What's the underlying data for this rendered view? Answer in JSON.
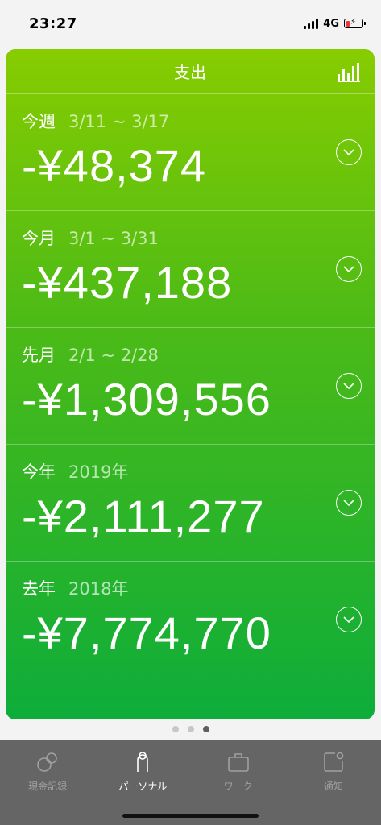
{
  "status_bar": {
    "time": "23:27",
    "network": "4G"
  },
  "card": {
    "title": "支出",
    "chart_icon": "bar-chart-icon",
    "rows": [
      {
        "label": "今週",
        "range": "3/11 ~ 3/17",
        "amount": "-¥48,374"
      },
      {
        "label": "今月",
        "range": "3/1 ~ 3/31",
        "amount": "-¥437,188"
      },
      {
        "label": "先月",
        "range": "2/1 ~ 2/28",
        "amount": "-¥1,309,556"
      },
      {
        "label": "今年",
        "range": "2019年",
        "amount": "-¥2,111,277"
      },
      {
        "label": "去年",
        "range": "2018年",
        "amount": "-¥7,774,770"
      }
    ]
  },
  "pager": {
    "count": 3,
    "active_index": 2
  },
  "tabs": [
    {
      "label": "現金記録",
      "icon": "coins-icon",
      "active": false
    },
    {
      "label": "パーソナル",
      "icon": "person-icon",
      "active": true
    },
    {
      "label": "ワーク",
      "icon": "briefcase-icon",
      "active": false
    },
    {
      "label": "通知",
      "icon": "notification-icon",
      "active": false
    }
  ],
  "colors": {
    "card_top": "#87cc00",
    "card_bottom": "#0dad3a",
    "tab_bar": "#656565"
  }
}
